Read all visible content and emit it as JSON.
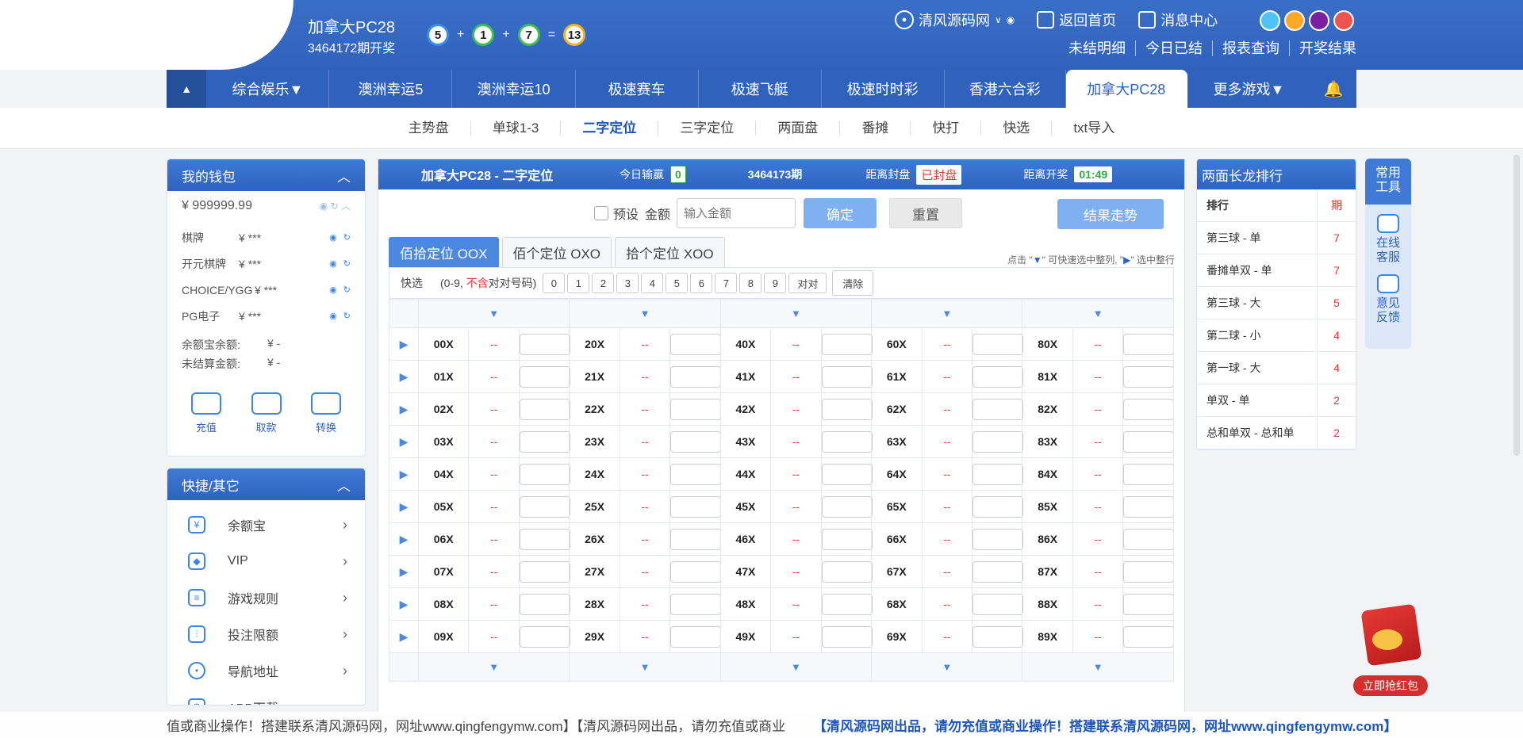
{
  "header": {
    "lottery_name": "加拿大PC28",
    "issue_text": "3464172期开奖",
    "balls": [
      "5",
      "1",
      "7"
    ],
    "ops": [
      "+",
      "+",
      "="
    ],
    "sum": "13",
    "user": "清风源码网",
    "home": "返回首页",
    "messages": "消息中心",
    "theme_colors": [
      "#4fc3f7",
      "#ffa726",
      "#7b1fa2",
      "#ef5350"
    ],
    "sub_links": [
      "未结明细",
      "今日已结",
      "报表查询",
      "开奖结果"
    ]
  },
  "nav": {
    "up": "▲",
    "items": [
      "综合娱乐▼",
      "澳洲幸运5",
      "澳洲幸运10",
      "极速赛车",
      "极速飞艇",
      "极速时时彩",
      "香港六合彩",
      "加拿大PC28",
      "更多游戏▼"
    ],
    "active_index": 7
  },
  "subtabs": {
    "items": [
      "主势盘",
      "单球1-3",
      "二字定位",
      "三字定位",
      "两面盘",
      "番摊",
      "快打",
      "快选",
      "txt导入"
    ],
    "active_index": 2
  },
  "wallet": {
    "title": "我的钱包",
    "balance": "¥ 999999.99",
    "rows": [
      {
        "name": "棋牌",
        "value": "¥ ***"
      },
      {
        "name": "开元棋牌",
        "value": "¥ ***"
      },
      {
        "name": "CHOICE/YGG",
        "value": "¥ ***"
      },
      {
        "name": "PG电子",
        "value": "¥ ***"
      }
    ],
    "info": [
      {
        "name": "余额宝余额:",
        "value": "¥ -"
      },
      {
        "name": "未结算金额:",
        "value": "¥ -"
      }
    ],
    "actions": [
      "充值",
      "取款",
      "转换"
    ]
  },
  "quick": {
    "title": "快捷/其它",
    "items": [
      "余额宝",
      "VIP",
      "游戏规则",
      "投注限额",
      "导航地址",
      "APP下载"
    ]
  },
  "main": {
    "title": "加拿大PC28 - 二字定位",
    "today_label": "今日输赢",
    "today_value": "0",
    "issue": "3464173期",
    "close_label": "距离封盘",
    "close_status": "已封盘",
    "draw_label": "距离开奖",
    "draw_time": "01:49",
    "preset_label": "预设",
    "amount_label": "金额",
    "amount_placeholder": "输入金额",
    "ok": "确定",
    "reset": "重置",
    "trend": "结果走势",
    "pos_tabs": [
      "佰拾定位 OOX",
      "佰个定位 OXO",
      "拾个定位 XOO"
    ],
    "hint_pre": "点击 \"",
    "hint_mid": "\" 可快速选中整列, \"",
    "hint_post": "\" 选中整行",
    "hint_down": "▼",
    "hint_right": "▶",
    "quick_label": "快选",
    "quick_note_1": "(0-9, ",
    "quick_note_red": "不含",
    "quick_note_2": "对对号码)",
    "quick_nums": [
      "0",
      "1",
      "2",
      "3",
      "4",
      "5",
      "6",
      "7",
      "8",
      "9",
      "对对"
    ],
    "quick_clear": "清除",
    "arrow": "▼",
    "play": "▶",
    "odds": "--",
    "rows": [
      [
        "00X",
        "20X",
        "40X",
        "60X",
        "80X"
      ],
      [
        "01X",
        "21X",
        "41X",
        "61X",
        "81X"
      ],
      [
        "02X",
        "22X",
        "42X",
        "62X",
        "82X"
      ],
      [
        "03X",
        "23X",
        "43X",
        "63X",
        "83X"
      ],
      [
        "04X",
        "24X",
        "44X",
        "64X",
        "84X"
      ],
      [
        "05X",
        "25X",
        "45X",
        "65X",
        "85X"
      ],
      [
        "06X",
        "26X",
        "46X",
        "66X",
        "86X"
      ],
      [
        "07X",
        "27X",
        "47X",
        "67X",
        "87X"
      ],
      [
        "08X",
        "28X",
        "48X",
        "68X",
        "88X"
      ],
      [
        "09X",
        "29X",
        "49X",
        "69X",
        "89X"
      ]
    ]
  },
  "rank": {
    "title": "两面长龙排行",
    "col1": "排行",
    "col2": "期",
    "rows": [
      {
        "name": "第三球 - 单",
        "value": "7"
      },
      {
        "name": "番摊单双 - 单",
        "value": "7"
      },
      {
        "name": "第三球 - 大",
        "value": "5"
      },
      {
        "name": "第二球 - 小",
        "value": "4"
      },
      {
        "name": "第一球 - 大",
        "value": "4"
      },
      {
        "name": "单双 - 单",
        "value": "2"
      },
      {
        "name": "总和单双 - 总和单",
        "value": "2"
      }
    ]
  },
  "tools": {
    "title_1": "常用",
    "title_2": "工具",
    "service_1": "在线",
    "service_2": "客服",
    "feedback_1": "意见",
    "feedback_2": "反馈"
  },
  "redpack": "立即抢红包",
  "marquee": {
    "text_1": "值或商业操作！搭建联系清风源码网，网址www.qingfengymw.com】【清风源码网出品，请勿充值或商业",
    "text_2": "【清风源码网出品，请勿充值或商业操作！搭建联系清风源码网，网址www.qingfengymw.com】"
  }
}
